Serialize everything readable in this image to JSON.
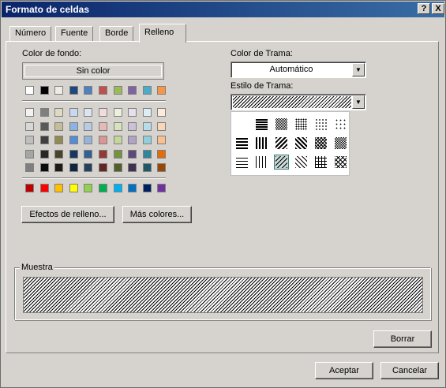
{
  "window": {
    "title": "Formato de celdas",
    "help_label": "?",
    "close_label": "X"
  },
  "tabs": [
    {
      "label": "Número",
      "active": false
    },
    {
      "label": "Fuente",
      "active": false
    },
    {
      "label": "Borde",
      "active": false
    },
    {
      "label": "Relleno",
      "active": true
    }
  ],
  "fill": {
    "background_label": "Color de fondo:",
    "no_color_label": "Sin color",
    "theme_row": [
      "#ffffff",
      "#000000",
      "#eeece1",
      "#1f497d",
      "#4f81bd",
      "#c0504d",
      "#9bbb59",
      "#8064a2",
      "#4bacc6",
      "#f79646"
    ],
    "shade_rows": [
      [
        "#f2f2f2",
        "#7f7f7f",
        "#ddd9c3",
        "#c6d9f0",
        "#dbe5f1",
        "#f2dcdb",
        "#ebf1dd",
        "#e5e0ec",
        "#dbeef3",
        "#fdeada"
      ],
      [
        "#d8d8d8",
        "#595959",
        "#c4bd97",
        "#8db3e2",
        "#b8cce4",
        "#e5b9b7",
        "#d7e3bc",
        "#ccc1d9",
        "#b7dde8",
        "#fbd5b5"
      ],
      [
        "#bfbfbf",
        "#3f3f3f",
        "#938953",
        "#548dd4",
        "#95b3d7",
        "#d99694",
        "#c3d69b",
        "#b2a2c7",
        "#92cddc",
        "#fac08f"
      ],
      [
        "#a5a5a5",
        "#262626",
        "#494429",
        "#17365d",
        "#366092",
        "#953734",
        "#76923c",
        "#5f497a",
        "#31859b",
        "#e36c09"
      ],
      [
        "#7f7f7f",
        "#0c0c0c",
        "#1d1b10",
        "#0f243e",
        "#244061",
        "#632423",
        "#4f6128",
        "#3f3151",
        "#205867",
        "#974806"
      ]
    ],
    "standard_row": [
      "#c00000",
      "#ff0000",
      "#ffc000",
      "#ffff00",
      "#92d050",
      "#00b050",
      "#00b0f0",
      "#0070c0",
      "#002060",
      "#7030a0"
    ],
    "fill_effects_label": "Efectos de relleno...",
    "more_colors_label": "Más colores..."
  },
  "pattern": {
    "color_label": "Color de Trama:",
    "color_value": "Automático",
    "style_label": "Estilo de Trama:",
    "styles": [
      [
        "solid-75",
        "dense-50",
        "dense-25",
        "dense-12",
        "dense-6"
      ],
      [
        "horizontal-thick",
        "vertical-thick",
        "reverse-diag-thick",
        "diag-thick",
        "diag-crosshatch",
        "thick-crosshatch"
      ],
      [
        "horizontal-thin",
        "vertical-thin",
        "reverse-diag-thin",
        "diag-thin",
        "grid-thin",
        "trellis-thin"
      ]
    ],
    "selected_style": "reverse-diag-thin"
  },
  "sample": {
    "label": "Muestra"
  },
  "buttons": {
    "clear": "Borrar",
    "ok": "Aceptar",
    "cancel": "Cancelar"
  }
}
